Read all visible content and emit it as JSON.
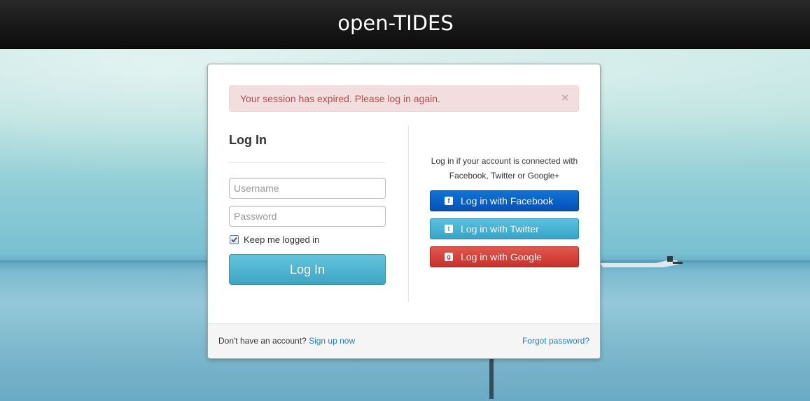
{
  "header": {
    "logo_text": "open-TIDES"
  },
  "alert": {
    "message": "Your session has expired. Please log in again.",
    "close_symbol": "×"
  },
  "login": {
    "title": "Log In",
    "username_placeholder": "Username",
    "password_placeholder": "Password",
    "remember_label": "Keep me logged in",
    "remember_checked": true,
    "submit_label": "Log In"
  },
  "social": {
    "note": "Log in if your account is connected with Facebook, Twitter or Google+",
    "buttons": [
      {
        "label": "Log in with Facebook",
        "icon": "facebook-icon",
        "color": "#0451b8"
      },
      {
        "label": "Log in with Twitter",
        "icon": "twitter-icon",
        "color": "#36a5c8"
      },
      {
        "label": "Log in with Google",
        "icon": "google-icon",
        "color": "#c8312a"
      }
    ]
  },
  "footer": {
    "signup_prompt": "Don't have an account?",
    "signup_link": "Sign up now",
    "forgot_link": "Forgot password?"
  }
}
